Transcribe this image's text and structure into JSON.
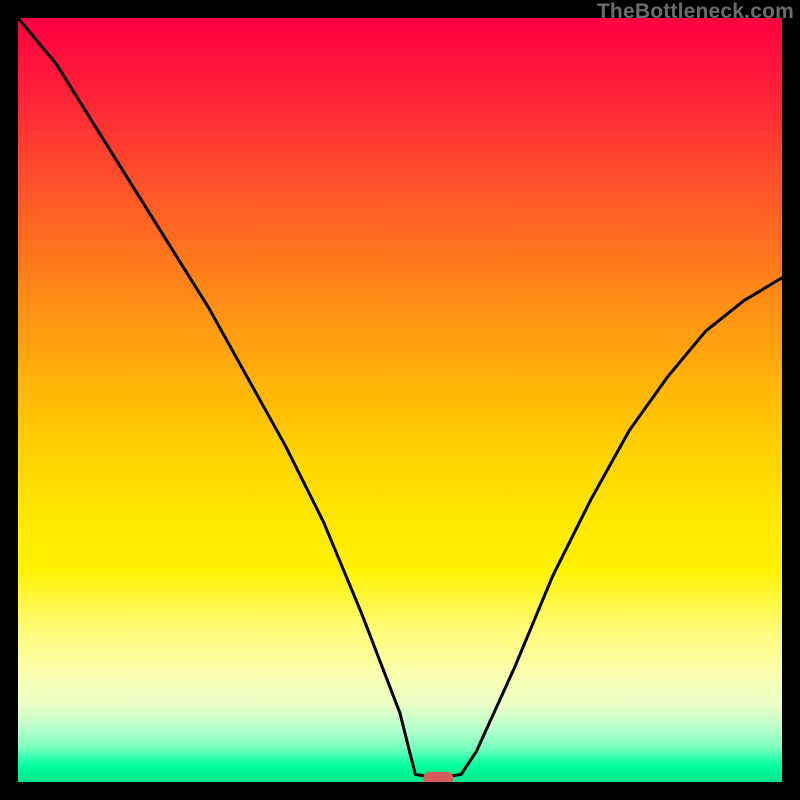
{
  "attribution": "TheBottleneck.com",
  "colors": {
    "frame": "#000000",
    "curve": "#000000",
    "marker": "#d85a5a",
    "gradient_top": "#ff0040",
    "gradient_mid": "#ffe400",
    "gradient_bottom": "#00e68f"
  },
  "chart_data": {
    "type": "line",
    "title": "",
    "xlabel": "",
    "ylabel": "",
    "xlim": [
      0,
      100
    ],
    "ylim": [
      0,
      100
    ],
    "grid": false,
    "legend": false,
    "x": [
      0,
      5,
      10,
      15,
      20,
      25,
      30,
      35,
      40,
      45,
      50,
      52,
      55,
      58,
      60,
      65,
      70,
      75,
      80,
      85,
      90,
      95,
      100
    ],
    "values": [
      100,
      94,
      86,
      78,
      70,
      62,
      53,
      44,
      34,
      22,
      9,
      1,
      0.5,
      1,
      4,
      15,
      27,
      37,
      46,
      53,
      59,
      63,
      66
    ],
    "annotations": [
      {
        "type": "marker",
        "shape": "pill",
        "x": 55,
        "y": 0.5,
        "color": "#d85a5a"
      }
    ],
    "notes": "V-shaped bottleneck curve. Y is mismatch percentage (0 = ideal, green band at bottom). X is relative hardware spec. Minimum near x≈55 marks the balanced configuration."
  }
}
